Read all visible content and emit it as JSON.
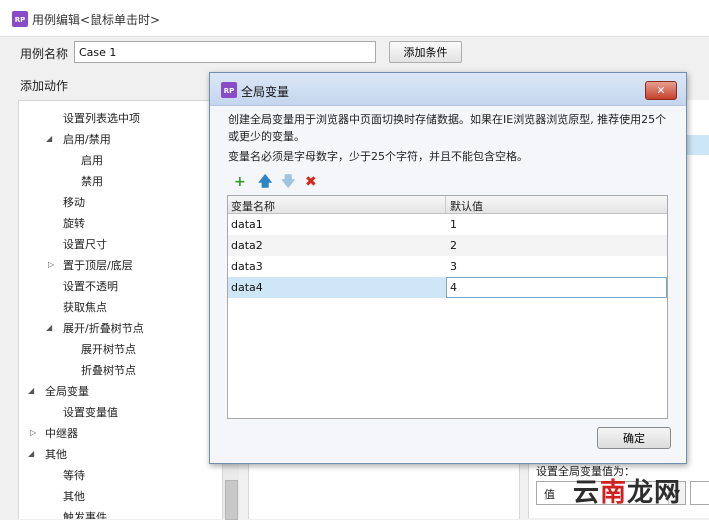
{
  "main_window": {
    "logo_text": "RP",
    "title": "用例编辑<鼠标单击时>",
    "case_name_label": "用例名称",
    "case_name_value": "Case 1",
    "add_condition_label": "添加条件",
    "add_action_label": "添加动作"
  },
  "action_tree": [
    {
      "label": "设置列表选中项",
      "arrow": ""
    },
    {
      "label": "启用/禁用",
      "arrow": "◢"
    },
    {
      "label": "启用",
      "arrow": ""
    },
    {
      "label": "禁用",
      "arrow": ""
    },
    {
      "label": "移动",
      "arrow": ""
    },
    {
      "label": "旋转",
      "arrow": ""
    },
    {
      "label": "设置尺寸",
      "arrow": ""
    },
    {
      "label": "置于顶层/底层",
      "arrow": "▷"
    },
    {
      "label": "设置不透明",
      "arrow": ""
    },
    {
      "label": "获取焦点",
      "arrow": ""
    },
    {
      "label": "展开/折叠树节点",
      "arrow": "◢"
    },
    {
      "label": "展开树节点",
      "arrow": ""
    },
    {
      "label": "折叠树节点",
      "arrow": ""
    },
    {
      "label": "全局变量",
      "arrow": "◢"
    },
    {
      "label": "设置变量值",
      "arrow": ""
    },
    {
      "label": "中继器",
      "arrow": "▷"
    },
    {
      "label": "其他",
      "arrow": "◢"
    },
    {
      "label": "等待",
      "arrow": ""
    },
    {
      "label": "其他",
      "arrow": ""
    },
    {
      "label": "触发事件",
      "arrow": ""
    }
  ],
  "right_panel": {
    "set_global_label": "设置全局变量值为：",
    "value_type_selected": "值"
  },
  "watermark": {
    "part1": "云",
    "part2": "南",
    "part3": "龙网"
  },
  "dialog": {
    "logo_text": "RP",
    "title": "全局变量",
    "close_label": "✕",
    "description_line1": "创建全局变量用于浏览器中页面切换时存储数据。如果在IE浏览器浏览原型, 推荐使用25个或更少的变量。",
    "description_line2": "变量名必须是字母数字，少于25个字符，并且不能包含空格。",
    "toolbar": {
      "add_icon": "+",
      "up_icon": "🡅",
      "down_icon": "🡇",
      "delete_icon": "✖"
    },
    "columns": [
      "变量名称",
      "默认值"
    ],
    "rows": [
      {
        "name": "data1",
        "value": "1"
      },
      {
        "name": "data2",
        "value": "2"
      },
      {
        "name": "data3",
        "value": "3"
      },
      {
        "name": "data4",
        "value": "4"
      }
    ],
    "ok_label": "确定"
  }
}
